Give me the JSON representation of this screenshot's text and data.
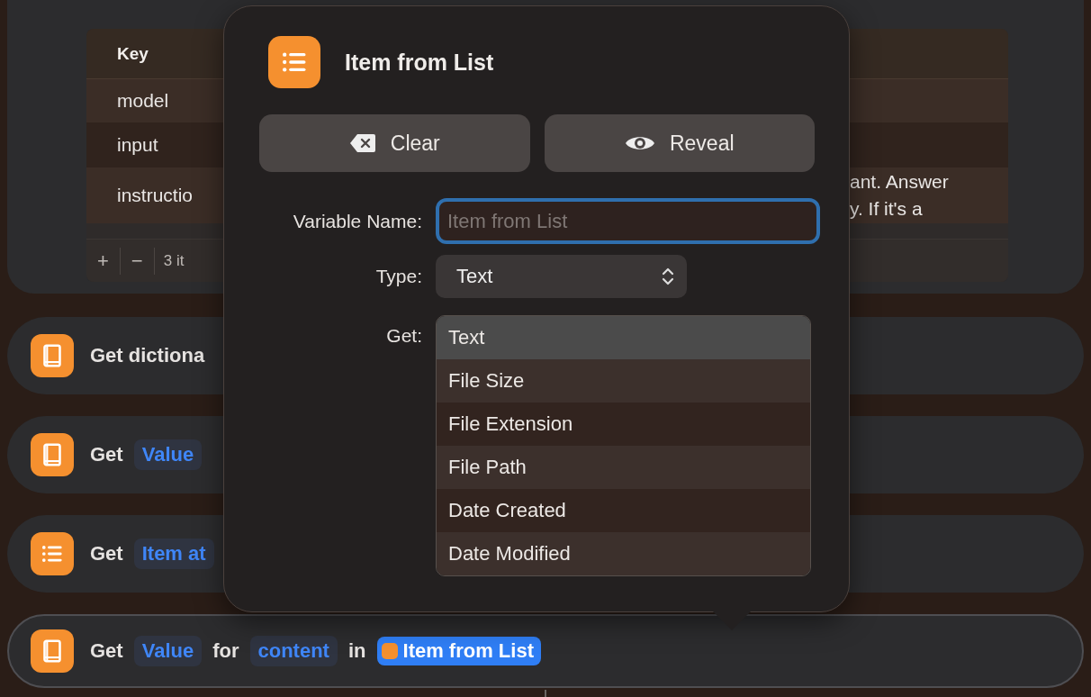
{
  "parameters_table": {
    "columns": [
      "Key"
    ],
    "rows": [
      {
        "key": "model",
        "value_lines": []
      },
      {
        "key": "input",
        "value_lines": []
      },
      {
        "key": "instructio",
        "value_lines": [
          "ant. Answer",
          "y. If it's a"
        ]
      }
    ],
    "footer": {
      "add_button": "+",
      "remove_button": "−",
      "count": "3 it"
    }
  },
  "actions": [
    {
      "kind": "book",
      "selected": false,
      "parts": [
        {
          "kind": "text",
          "text": "Get dictiona"
        }
      ]
    },
    {
      "kind": "book",
      "selected": false,
      "parts": [
        {
          "kind": "text",
          "text": "Get"
        },
        {
          "kind": "token",
          "text": "Value"
        }
      ]
    },
    {
      "kind": "list",
      "selected": false,
      "parts": [
        {
          "kind": "text",
          "text": "Get"
        },
        {
          "kind": "token",
          "text": "Item at"
        }
      ]
    },
    {
      "kind": "book",
      "selected": true,
      "parts": [
        {
          "kind": "text",
          "text": "Get"
        },
        {
          "kind": "token",
          "text": "Value"
        },
        {
          "kind": "text",
          "text": "for"
        },
        {
          "kind": "token",
          "text": "content"
        },
        {
          "kind": "text",
          "text": "in"
        },
        {
          "kind": "variable",
          "text": "Item from List"
        }
      ]
    }
  ],
  "popover": {
    "title": "Item from List",
    "buttons": [
      {
        "kind": "clear",
        "label": "Clear"
      },
      {
        "kind": "reveal",
        "label": "Reveal"
      }
    ],
    "variable_name": {
      "label": "Variable Name:",
      "placeholder": "Item from List",
      "focused": true
    },
    "type": {
      "label": "Type:",
      "value": "Text"
    },
    "get": {
      "label": "Get:",
      "options": [
        {
          "label": "Text",
          "selected": true
        },
        {
          "label": "File Size",
          "selected": false
        },
        {
          "label": "File Extension",
          "selected": false
        },
        {
          "label": "File Path",
          "selected": false
        },
        {
          "label": "Date Created",
          "selected": false
        },
        {
          "label": "Date Modified",
          "selected": false
        }
      ]
    }
  }
}
